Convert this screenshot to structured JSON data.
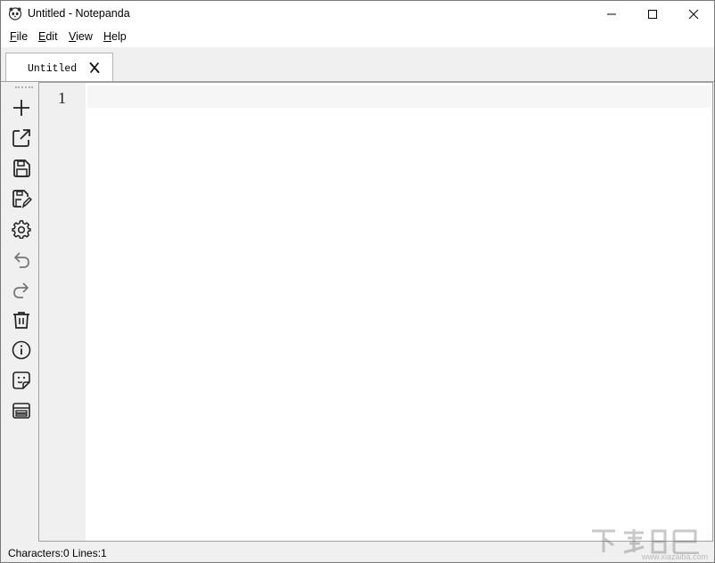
{
  "window": {
    "title": "Untitled - Notepanda"
  },
  "menu": {
    "items": [
      {
        "accel": "F",
        "rest": "ile"
      },
      {
        "accel": "E",
        "rest": "dit"
      },
      {
        "accel": "V",
        "rest": "iew"
      },
      {
        "accel": "H",
        "rest": "elp"
      }
    ]
  },
  "tabs": [
    {
      "label": "Untitled"
    }
  ],
  "toolbar": {
    "icons": [
      "new-icon",
      "open-external-icon",
      "save-icon",
      "save-as-icon",
      "settings-icon",
      "undo-icon",
      "redo-icon",
      "delete-icon",
      "info-icon",
      "sticker-icon",
      "layout-icon"
    ]
  },
  "editor": {
    "line_numbers": [
      "1"
    ],
    "content": ""
  },
  "status": {
    "text": "Characters:0 Lines:1"
  },
  "watermark": {
    "text": "www.xiazaiba.com"
  },
  "colors": {
    "chrome": "#f0f0f0",
    "editor": "#ffffff",
    "current_line": "#f6f6f6"
  }
}
